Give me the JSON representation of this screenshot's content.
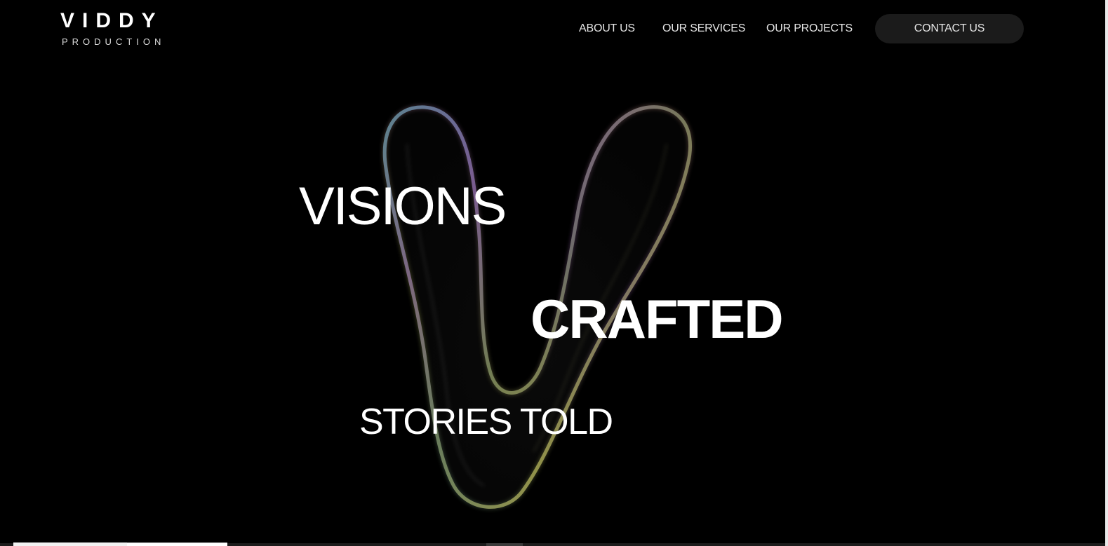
{
  "header": {
    "logo_main": "VIDDY",
    "logo_sub": "PRODUCTION",
    "nav": [
      {
        "label": "ABOUT US"
      },
      {
        "label": "OUR SERVICES"
      },
      {
        "label": "OUR PROJECTS"
      }
    ],
    "contact_label": "CONTACT US"
  },
  "hero": {
    "line1": "VISIONS",
    "line2": "CRAFTED",
    "line3": "STORIES TOLD",
    "graphic_icon": "iridescent-v-shape-icon"
  },
  "colors": {
    "background": "#000000",
    "text": "#ffffff",
    "button_bg": "#1b1b1b"
  }
}
